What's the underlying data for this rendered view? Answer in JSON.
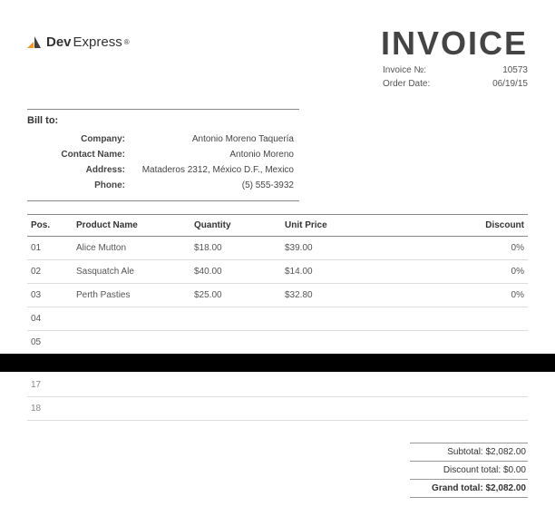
{
  "logo": {
    "prefix": "Dev",
    "suffix": "Express",
    "reg": "®"
  },
  "header": {
    "title": "INVOICE",
    "invoice_no_label": "Invoice №:",
    "invoice_no": "10573",
    "order_date_label": "Order Date:",
    "order_date": "06/19/15"
  },
  "billto": {
    "title": "Bill to:",
    "rows": [
      {
        "label": "Company:",
        "value": "Antonio Moreno Taquería"
      },
      {
        "label": "Contact Name:",
        "value": "Antonio Moreno"
      },
      {
        "label": "Address:",
        "value": "Mataderos  2312, México D.F., Mexico"
      },
      {
        "label": "Phone:",
        "value": "(5) 555-3932"
      }
    ]
  },
  "columns": {
    "pos": "Pos.",
    "name": "Product Name",
    "qty": "Quantity",
    "price": "Unit Price",
    "disc": "Discount"
  },
  "items": [
    {
      "pos": "01",
      "name": "Alice Mutton",
      "qty": "$18.00",
      "price": "$39.00",
      "disc": "0%"
    },
    {
      "pos": "02",
      "name": "Sasquatch Ale",
      "qty": "$40.00",
      "price": "$14.00",
      "disc": "0%"
    },
    {
      "pos": "03",
      "name": "Perth Pasties",
      "qty": "$25.00",
      "price": "$32.80",
      "disc": "0%"
    },
    {
      "pos": "04",
      "name": "",
      "qty": "",
      "price": "",
      "disc": ""
    },
    {
      "pos": "05",
      "name": "",
      "qty": "",
      "price": "",
      "disc": ""
    }
  ],
  "lower_rows": [
    {
      "pos": "17"
    },
    {
      "pos": "18"
    }
  ],
  "totals": {
    "subtotal_label": "Subtotal:",
    "subtotal": "$2,082.00",
    "discount_label": "Discount total:",
    "discount": "$0.00",
    "grand_label": "Grand total:",
    "grand": "$2,082.00"
  }
}
